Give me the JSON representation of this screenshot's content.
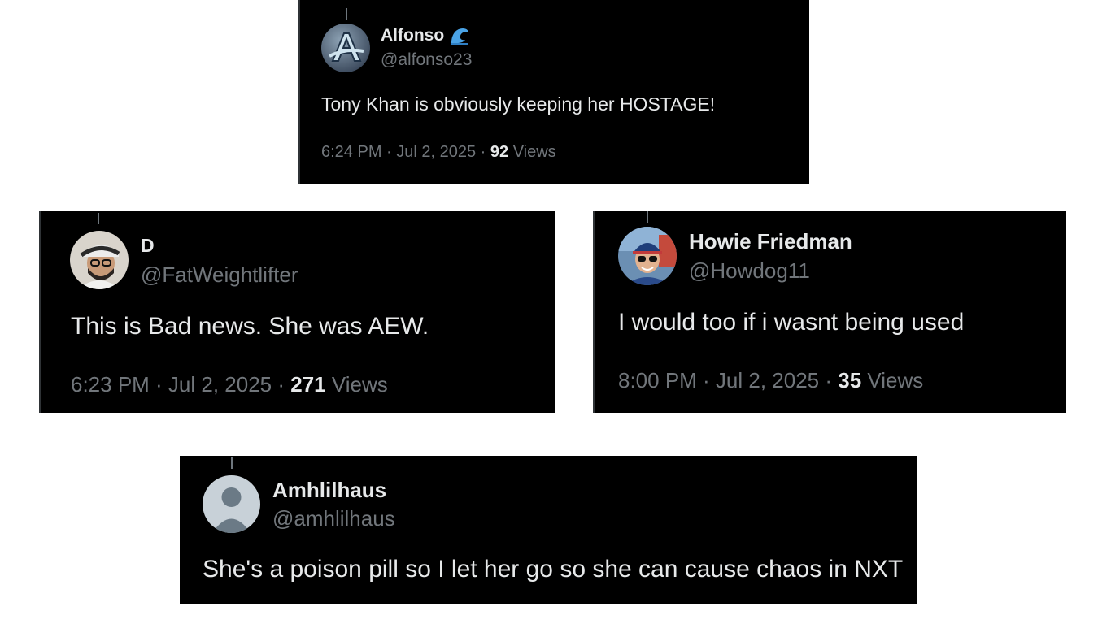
{
  "posts": [
    {
      "name": "Alfonso",
      "badge_icon": "wave-emoji-icon",
      "handle": "@alfonso23",
      "text": "Tony Khan is obviously keeping her HOSTAGE!",
      "time": "6:24 PM · Jul 2, 2025 · ",
      "views_count": "92",
      "views_label": " Views"
    },
    {
      "name": "D",
      "handle": "@FatWeightlifter",
      "text": "This is Bad news.  She was AEW.",
      "time": "6:23 PM · Jul 2, 2025 · ",
      "views_count": "271",
      "views_label": " Views"
    },
    {
      "name": "Howie Friedman",
      "handle": "@Howdog11",
      "text": "I would too if i wasnt being used",
      "time": "8:00 PM · Jul 2, 2025 · ",
      "views_count": "35",
      "views_label": " Views"
    },
    {
      "name": "Amhlilhaus",
      "handle": "@amhlilhaus",
      "text": "She's a poison pill so I let her go so she can cause chaos in NXT"
    }
  ],
  "colors": {
    "card_bg": "#000000",
    "primary_text": "#e7e9ea",
    "secondary_text": "#71767b",
    "page_bg": "#ffffff"
  }
}
